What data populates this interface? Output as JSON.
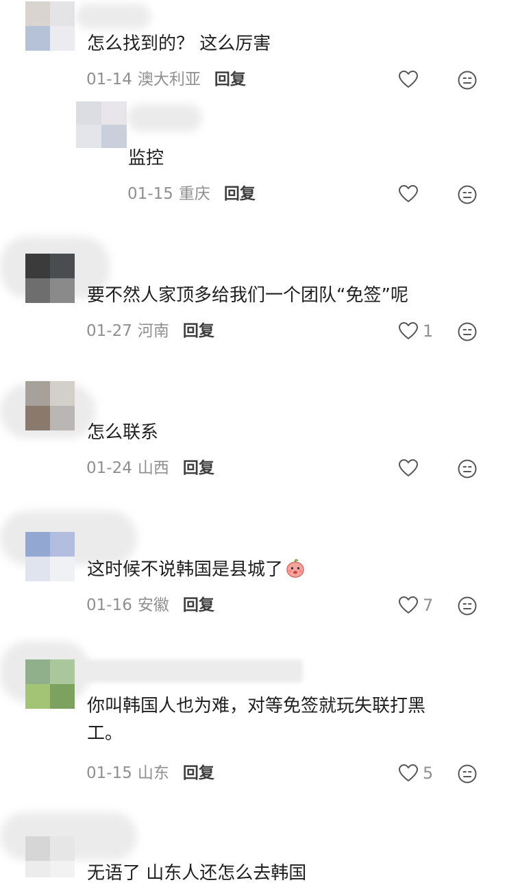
{
  "reply_label": "回复",
  "colors": {
    "text": "#1f1f1f",
    "meta": "#8f8f8f",
    "reply": "#3d3d3d",
    "icon": "#555555"
  },
  "comments": [
    {
      "text": "怎么找到的？ 这么厉害",
      "date": "01-14",
      "location": "澳大利亚",
      "likes": ""
    },
    {
      "text": "监控",
      "date": "01-15",
      "location": "重庆",
      "likes": ""
    },
    {
      "text": "要不然人家顶多给我们一个团队“免签”呢",
      "date": "01-27",
      "location": "河南",
      "likes": "1"
    },
    {
      "text": "怎么联系",
      "date": "01-24",
      "location": "山西",
      "likes": ""
    },
    {
      "text": "这时候不说韩国是县城了",
      "emoji": "peach-face-emoji",
      "date": "01-16",
      "location": "安徽",
      "likes": "7"
    },
    {
      "text_line1": "你叫韩国人也为难，对等免签就玩失联打黑",
      "text_line2": "工。",
      "date": "01-15",
      "location": "山东",
      "likes": "5"
    },
    {
      "text": "无语了 山东人还怎么去韩国"
    }
  ]
}
